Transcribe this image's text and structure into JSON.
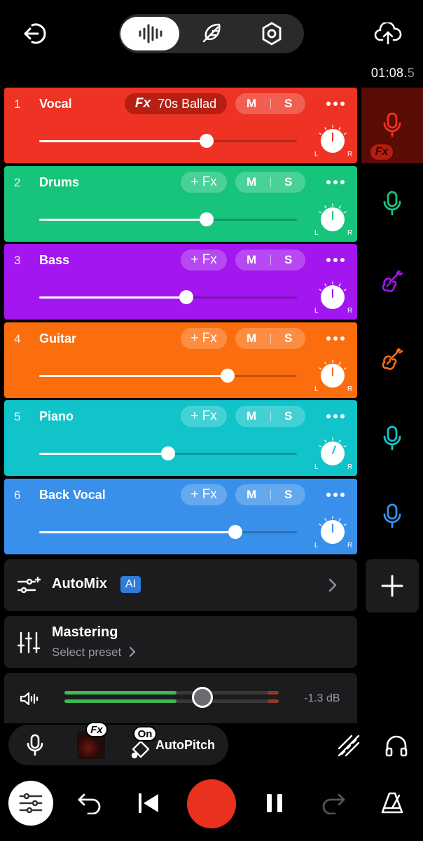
{
  "header": {
    "timecode_main": "01:08.",
    "timecode_frac": "5"
  },
  "tracks": [
    {
      "num": "1",
      "name": "Vocal",
      "fx_preset": "70s Ballad",
      "fx_label": "Fx",
      "mute": "M",
      "solo": "S",
      "color": "#ee3223",
      "volume": 0.65,
      "instrument": "mic"
    },
    {
      "num": "2",
      "name": "Drums",
      "fx_label": "+ Fx",
      "mute": "M",
      "solo": "S",
      "color": "#16c47c",
      "volume": 0.65,
      "instrument": "mic"
    },
    {
      "num": "3",
      "name": "Bass",
      "fx_label": "+ Fx",
      "mute": "M",
      "solo": "S",
      "color": "#a316f0",
      "volume": 0.57,
      "instrument": "guitar"
    },
    {
      "num": "4",
      "name": "Guitar",
      "fx_label": "+ Fx",
      "mute": "M",
      "solo": "S",
      "color": "#fc6d0e",
      "volume": 0.73,
      "instrument": "guitar"
    },
    {
      "num": "5",
      "name": "Piano",
      "fx_label": "+ Fx",
      "mute": "M",
      "solo": "S",
      "color": "#10c4ca",
      "volume": 0.5,
      "instrument": "mic"
    },
    {
      "num": "6",
      "name": "Back Vocal",
      "fx_label": "+ Fx",
      "mute": "M",
      "solo": "S",
      "color": "#3990ea",
      "volume": 0.76,
      "instrument": "mic"
    }
  ],
  "pan": {
    "left": "L",
    "right": "R"
  },
  "side": {
    "fx_badge": "Fx"
  },
  "automix": {
    "label": "AutoMix",
    "badge": "AI"
  },
  "mastering": {
    "label": "Mastering",
    "sublabel": "Select preset"
  },
  "master_volume": {
    "db_label": "-1.3 dB",
    "level": 0.55
  },
  "input_bar": {
    "fx_tag": "Fx",
    "on_tag": "On",
    "autopitch_label": "AutoPitch"
  },
  "colors": {
    "record": "#e8321f",
    "meter": "#3fb950",
    "ai_badge": "#2e7ddd"
  }
}
